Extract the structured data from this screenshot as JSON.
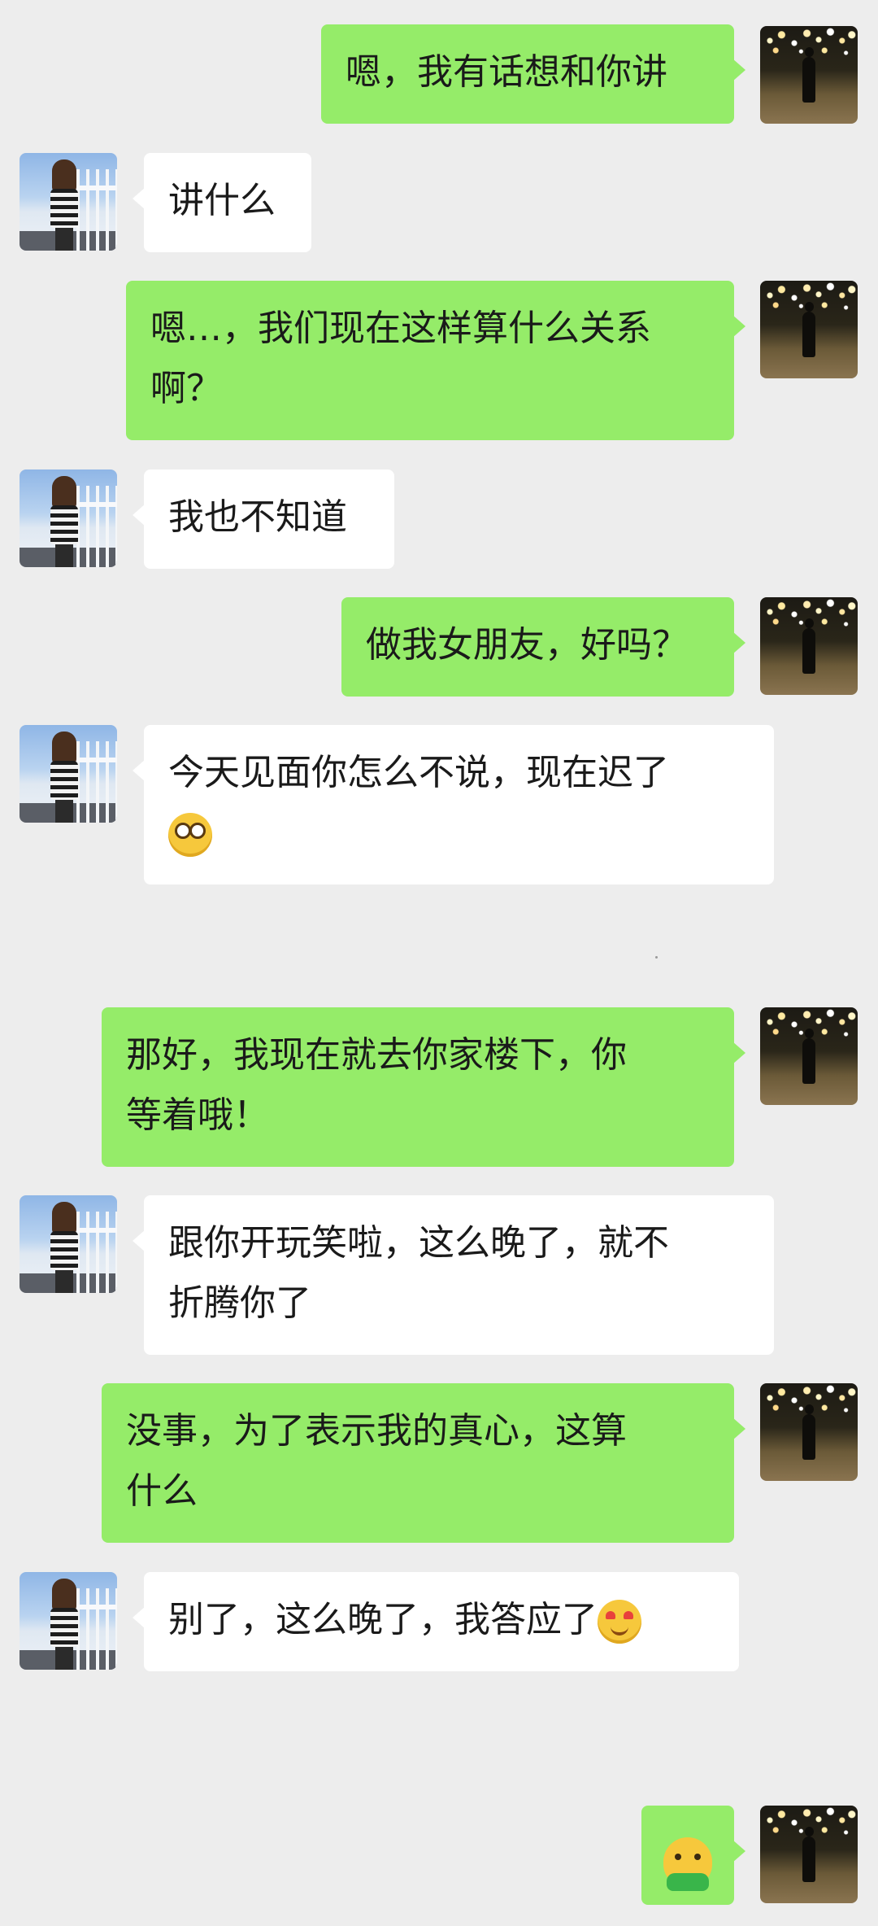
{
  "messages": [
    {
      "side": "out",
      "text": "嗯，我有话想和你讲"
    },
    {
      "side": "in",
      "text": "讲什么"
    },
    {
      "side": "out",
      "line1": "嗯…，我们现在这样算什么关系",
      "line2": "啊？"
    },
    {
      "side": "in",
      "text": "我也不知道"
    },
    {
      "side": "out",
      "text": "做我女朋友，好吗？"
    },
    {
      "side": "in",
      "line1": "今天见面你怎么不说，现在迟了",
      "emoji": "dizzy-face-emoji"
    },
    {
      "side": "out",
      "line1": "那好，我现在就去你家楼下，你",
      "line2": "等着哦！"
    },
    {
      "side": "in",
      "line1": "跟你开玩笑啦，这么晚了，就不",
      "line2": "折腾你了"
    },
    {
      "side": "out",
      "line1": "没事，为了表示我的真心，这算",
      "line2": "什么"
    },
    {
      "side": "in",
      "text": "别了，这么晚了，我答应了",
      "emoji": "heart-eyes-emoji"
    },
    {
      "side": "out",
      "emoji": "sprout-smile-emoji"
    }
  ],
  "colors": {
    "background": "#ededed",
    "outgoing_bubble": "#95ec69",
    "incoming_bubble": "#ffffff"
  }
}
